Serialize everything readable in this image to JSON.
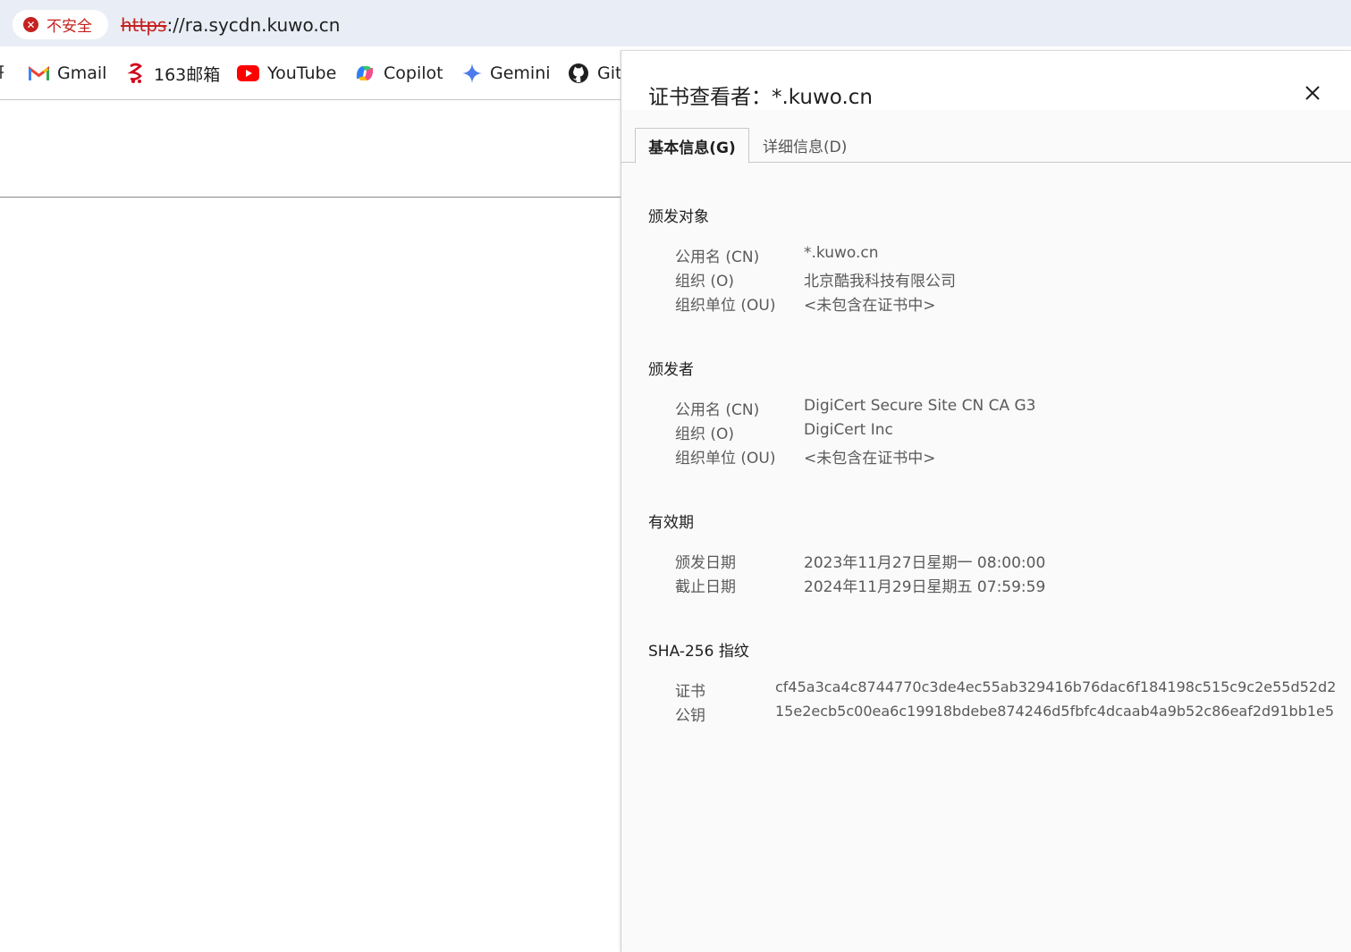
{
  "addressbar": {
    "security_label": "不安全",
    "url_scheme": "https",
    "url_rest": "://ra.sycdn.kuwo.cn"
  },
  "bookmarks": [
    {
      "label": "Gmail",
      "icon": "gmail-icon"
    },
    {
      "label": "163邮箱",
      "icon": "mail163-icon"
    },
    {
      "label": "YouTube",
      "icon": "youtube-icon"
    },
    {
      "label": "Copilot",
      "icon": "copilot-icon"
    },
    {
      "label": "Gemini",
      "icon": "gemini-icon"
    },
    {
      "label": "Git",
      "icon": "github-icon"
    }
  ],
  "dialog": {
    "title": "证书查看者：*.kuwo.cn",
    "tabs": [
      {
        "label": "基本信息(G)",
        "active": true
      },
      {
        "label": "详细信息(D)",
        "active": false
      }
    ],
    "issued_to": {
      "title": "颁发对象",
      "rows": [
        {
          "label": "公用名 (CN)",
          "value": "*.kuwo.cn"
        },
        {
          "label": "组织 (O)",
          "value": "北京酷我科技有限公司"
        },
        {
          "label": "组织单位 (OU)",
          "value": "<未包含在证书中>"
        }
      ]
    },
    "issued_by": {
      "title": "颁发者",
      "rows": [
        {
          "label": "公用名 (CN)",
          "value": "DigiCert Secure Site CN CA G3"
        },
        {
          "label": "组织 (O)",
          "value": "DigiCert Inc"
        },
        {
          "label": "组织单位 (OU)",
          "value": "<未包含在证书中>"
        }
      ]
    },
    "validity": {
      "title": "有效期",
      "rows": [
        {
          "label": "颁发日期",
          "value": "2023年11月27日星期一 08:00:00"
        },
        {
          "label": "截止日期",
          "value": "2024年11月29日星期五 07:59:59"
        }
      ]
    },
    "fingerprints": {
      "title": "SHA-256 指纹",
      "rows": [
        {
          "label": "证书",
          "value": "cf45a3ca4c8744770c3de4ec55ab329416b76dac6f184198c515c9c2e55d52d2"
        },
        {
          "label": "公钥",
          "value": "15e2ecb5c00ea6c19918bdebe874246d5fbfc4dcaab4a9b52c86eaf2d91bb1e5"
        }
      ]
    }
  },
  "colors": {
    "danger": "#c5221f",
    "toolbar_bg": "#e9eef6",
    "dialog_bg": "#fafafa"
  }
}
